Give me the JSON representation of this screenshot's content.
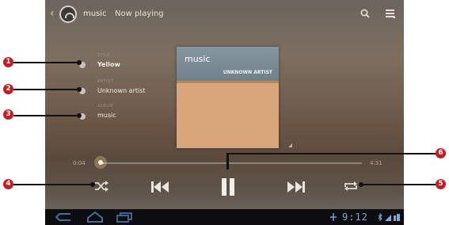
{
  "action_bar": {
    "app_title": "music",
    "section": "Now playing",
    "icons": [
      "back-chevron-icon",
      "headphones-app-icon",
      "search-icon",
      "overflow-menu-icon"
    ]
  },
  "track": {
    "title_label": "TITLE",
    "title": "Yellow",
    "artist_label": "ARTIST",
    "artist": "Unknown artist",
    "album_label": "ALBUM",
    "album": "music"
  },
  "album_art": {
    "title": "music",
    "artist": "UNKNOWN ARTIST",
    "colors": {
      "header": "#7b8c97",
      "body": "#d9a57a"
    }
  },
  "progress": {
    "elapsed": "0:04",
    "duration": "4:31",
    "fraction": 0.015
  },
  "controls": [
    "shuffle-icon",
    "previous-icon",
    "pause-icon",
    "next-icon",
    "repeat-icon"
  ],
  "system_bar": {
    "clock": "9:12",
    "icons": [
      "nav-back-icon",
      "nav-home-icon",
      "nav-recent-apps-icon",
      "usb-icon",
      "bluetooth-icon",
      "signal-icon",
      "battery-icon"
    ]
  },
  "callouts": [
    "1",
    "2",
    "3",
    "4",
    "5",
    "6"
  ],
  "colors": {
    "callout": "#c81a1f",
    "clock": "#7ca7d8"
  }
}
